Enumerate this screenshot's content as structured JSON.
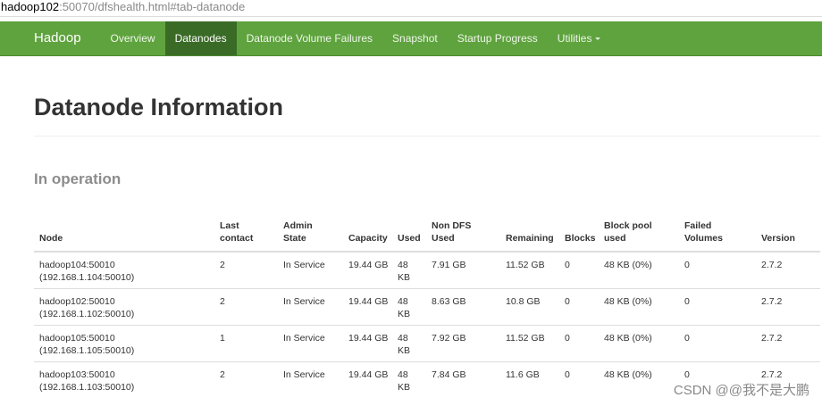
{
  "url": {
    "host": "hadoop102",
    "rest": ":50070/dfshealth.html#tab-datanode"
  },
  "navbar": {
    "brand": "Hadoop",
    "items": [
      "Overview",
      "Datanodes",
      "Datanode Volume Failures",
      "Snapshot",
      "Startup Progress",
      "Utilities"
    ],
    "active": "Datanodes"
  },
  "page": {
    "title": "Datanode Information",
    "section": "In operation"
  },
  "table": {
    "headers": [
      "Node",
      "Last contact",
      "Admin State",
      "Capacity",
      "Used",
      "Non DFS Used",
      "Remaining",
      "Blocks",
      "Block pool used",
      "Failed Volumes",
      "Version"
    ],
    "rows": [
      {
        "node": "hadoop104:50010",
        "ip": "(192.168.1.104:50010)",
        "last_contact": "2",
        "admin_state": "In Service",
        "capacity": "19.44 GB",
        "used": "48 KB",
        "non_dfs_used": "7.91 GB",
        "remaining": "11.52 GB",
        "blocks": "0",
        "block_pool_used": "48 KB (0%)",
        "failed_volumes": "0",
        "version": "2.7.2"
      },
      {
        "node": "hadoop102:50010",
        "ip": "(192.168.1.102:50010)",
        "last_contact": "2",
        "admin_state": "In Service",
        "capacity": "19.44 GB",
        "used": "48 KB",
        "non_dfs_used": "8.63 GB",
        "remaining": "10.8 GB",
        "blocks": "0",
        "block_pool_used": "48 KB (0%)",
        "failed_volumes": "0",
        "version": "2.7.2"
      },
      {
        "node": "hadoop105:50010",
        "ip": "(192.168.1.105:50010)",
        "last_contact": "1",
        "admin_state": "In Service",
        "capacity": "19.44 GB",
        "used": "48 KB",
        "non_dfs_used": "7.92 GB",
        "remaining": "11.52 GB",
        "blocks": "0",
        "block_pool_used": "48 KB (0%)",
        "failed_volumes": "0",
        "version": "2.7.2"
      },
      {
        "node": "hadoop103:50010",
        "ip": "(192.168.1.103:50010)",
        "last_contact": "2",
        "admin_state": "In Service",
        "capacity": "19.44 GB",
        "used": "48 KB",
        "non_dfs_used": "7.84 GB",
        "remaining": "11.6 GB",
        "blocks": "0",
        "block_pool_used": "48 KB (0%)",
        "failed_volumes": "0",
        "version": "2.7.2"
      }
    ]
  },
  "watermark": "CSDN @@我不是大鹏",
  "colors": {
    "navbar": "#5fa33e",
    "navbar_active": "#3a6b26",
    "section_title": "#8c8c8c"
  }
}
